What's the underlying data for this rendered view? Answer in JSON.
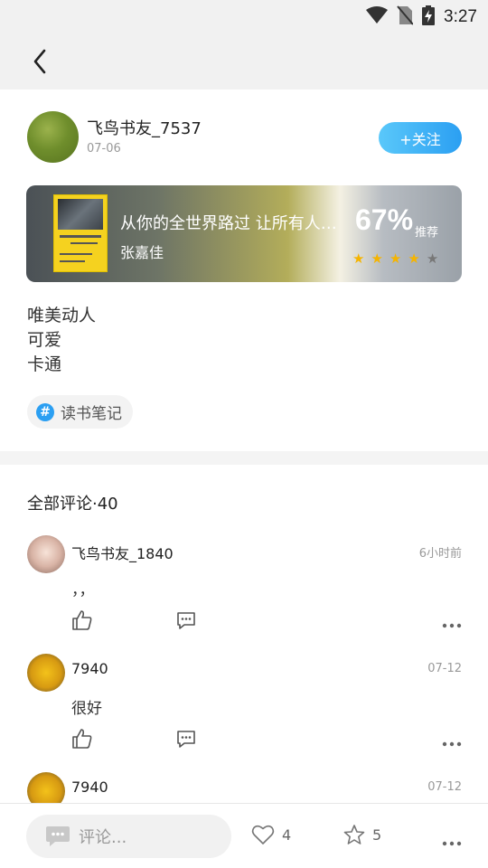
{
  "status_bar": {
    "time": "3:27"
  },
  "post": {
    "author_name": "飞鸟书友_7537",
    "date": "07-06",
    "follow_label": "+关注",
    "book": {
      "title": "从你的全世界路过 让所有人…",
      "author": "张嘉佳",
      "recommend_percent": "67%",
      "recommend_label": "推荐",
      "rating": 4,
      "rating_max": 5
    },
    "tags": [
      "唯美动人",
      "可爱",
      "卡通"
    ],
    "topic": "读书笔记"
  },
  "comments": {
    "title": "全部评论·40",
    "items": [
      {
        "name": "飞鸟书友_1840",
        "time": "6小时前",
        "text": "，，"
      },
      {
        "name": "7940",
        "time": "07-12",
        "text": "很好"
      },
      {
        "name": "7940",
        "time": "07-12",
        "text": ""
      }
    ]
  },
  "bottom_bar": {
    "comment_placeholder": "评论...",
    "like_count": "4",
    "favorite_count": "5"
  },
  "colors": {
    "accent": "#2b9ff2",
    "star_active": "#f5b400",
    "star_inactive": "#777777"
  }
}
